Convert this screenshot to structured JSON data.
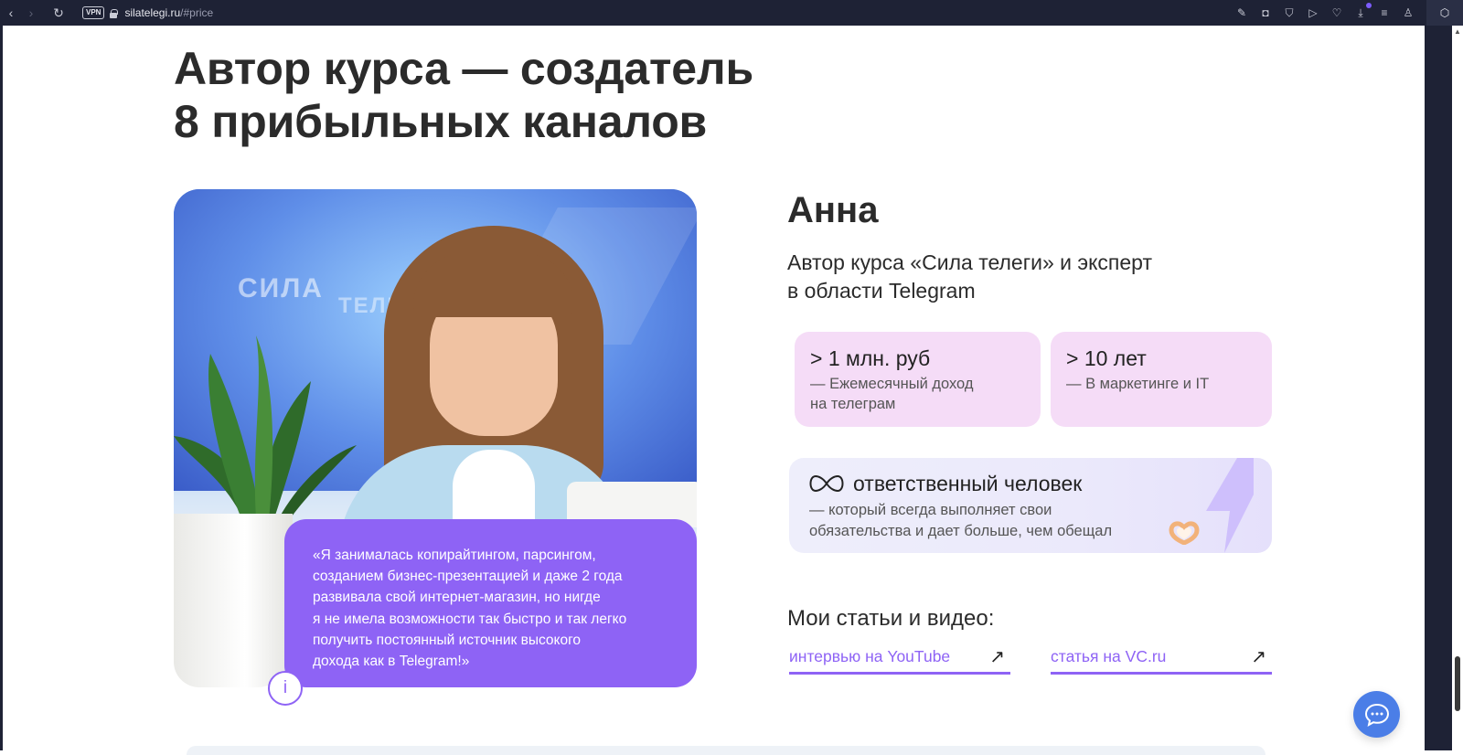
{
  "browser": {
    "url_host": "silatelegi.ru",
    "url_path": "/#price",
    "vpn_label": "VPN"
  },
  "section": {
    "title_line1": "Автор курса — создатель",
    "title_line2": "8 прибыльных каналов"
  },
  "photo": {
    "screen_text_1": "СИЛА",
    "screen_text_2": "ТЕЛЕ"
  },
  "quote": {
    "text": "«Я занималась копирайтингом, парсингом,\nсозданием бизнес-презентацией и даже 2 года\nразвивала свой интернет-магазин, но нигде\nя не имела возможности так быстро и так легко\nполучить постоянный источник высокого\nдохода как в Telegram!»",
    "info_label": "i"
  },
  "author": {
    "name": "Анна",
    "description": "Автор курса «Сила телеги» и эксперт\nв области Telegram"
  },
  "stats": [
    {
      "value": "> 1 млн. руб",
      "caption": "— Ежемесячный доход\nна телеграм"
    },
    {
      "value": "> 10 лет",
      "caption": "— В маркетинге и IT"
    }
  ],
  "responsibility": {
    "title": "ответственный человек",
    "caption": "— который всегда выполняет свои\nобязательства и дает больше, чем обещал",
    "icon": "infinity-icon"
  },
  "links": {
    "title": "Мои статьи и видео:",
    "items": [
      {
        "label": "интервью на YouTube",
        "arrow": "↗"
      },
      {
        "label": "статья на VC.ru",
        "arrow": "↗"
      }
    ]
  },
  "colors": {
    "accent": "#8e63f5",
    "stat_card_bg": "#f5dcf7",
    "chat_button": "#4b7ee7",
    "browser_bar": "#1e2235"
  }
}
